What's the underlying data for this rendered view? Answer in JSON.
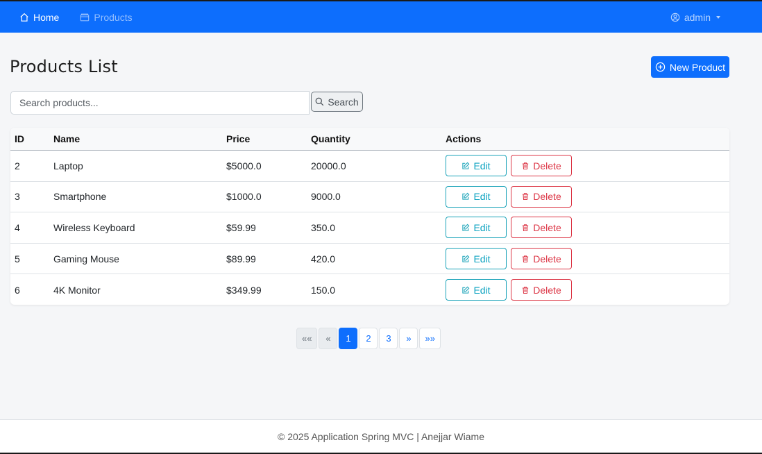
{
  "navbar": {
    "home_label": "Home",
    "products_label": "Products",
    "user_label": "admin",
    "color": "#0d6efd"
  },
  "page": {
    "title": "Products List",
    "new_product_label": "New Product"
  },
  "search": {
    "placeholder": "Search products...",
    "value": "",
    "button_label": "Search"
  },
  "table": {
    "headers": {
      "id": "ID",
      "name": "Name",
      "price": "Price",
      "quantity": "Quantity",
      "actions": "Actions"
    },
    "edit_label": "Edit",
    "delete_label": "Delete",
    "rows": [
      {
        "id": "2",
        "name": "Laptop",
        "price": "$5000.0",
        "quantity": "20000.0"
      },
      {
        "id": "3",
        "name": "Smartphone",
        "price": "$1000.0",
        "quantity": "9000.0"
      },
      {
        "id": "4",
        "name": "Wireless Keyboard",
        "price": "$59.99",
        "quantity": "350.0"
      },
      {
        "id": "5",
        "name": "Gaming Mouse",
        "price": "$89.99",
        "quantity": "420.0"
      },
      {
        "id": "6",
        "name": "4K Monitor",
        "price": "$349.99",
        "quantity": "150.0"
      }
    ]
  },
  "pagination": {
    "first": "««",
    "prev": "«",
    "pages": [
      "1",
      "2",
      "3"
    ],
    "current": "1",
    "next": "»",
    "last": "»»"
  },
  "footer": {
    "text": "© 2025 Application Spring MVC | Anejjar Wiame"
  }
}
